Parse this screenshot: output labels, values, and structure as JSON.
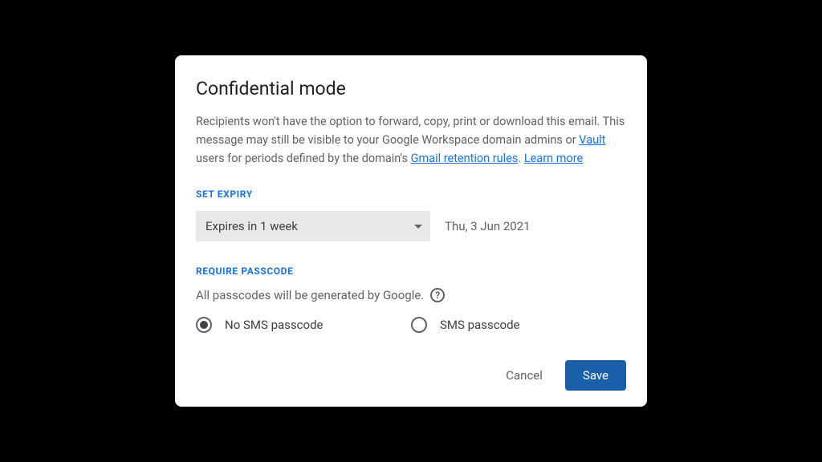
{
  "dialog": {
    "title": "Confidential mode",
    "description_pre": "Recipients won't have the option to forward, copy, print or download this email. This message may still be visible to your Google Workspace domain admins or ",
    "link_vault": "Vault",
    "description_mid": " users for periods defined by the domain's ",
    "link_retention": "Gmail retention rules",
    "description_sep": ". ",
    "link_learnmore": "Learn more"
  },
  "expiry": {
    "label": "SET EXPIRY",
    "selected": "Expires in 1 week",
    "date": "Thu, 3 Jun 2021"
  },
  "passcode": {
    "label": "REQUIRE PASSCODE",
    "note": "All passcodes will be generated by Google.",
    "options": {
      "no_sms": "No SMS passcode",
      "sms": "SMS passcode"
    }
  },
  "footer": {
    "cancel": "Cancel",
    "save": "Save"
  }
}
